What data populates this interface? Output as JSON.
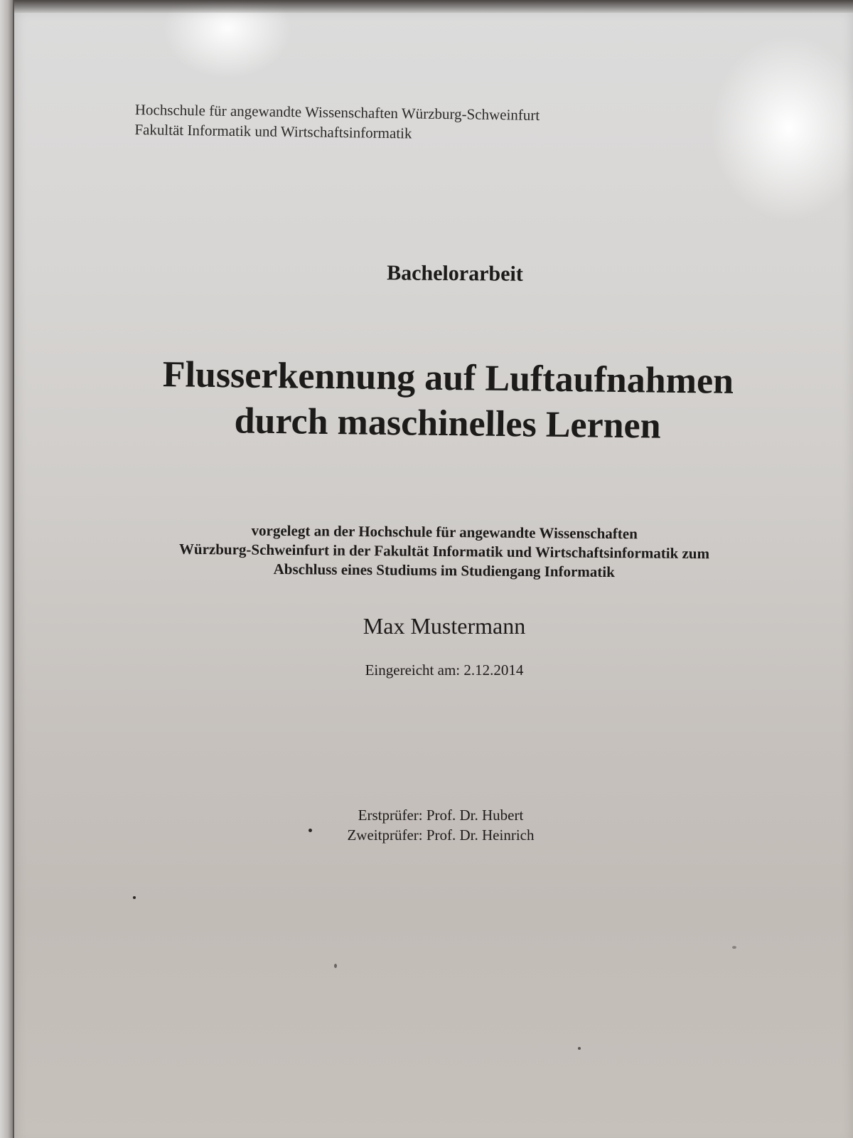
{
  "institution": {
    "line1": "Hochschule für angewandte Wissenschaften Würzburg-Schweinfurt",
    "line2": "Fakultät Informatik und Wirtschaftsinformatik"
  },
  "document_type": "Bachelorarbeit",
  "title": {
    "line1": "Flusserkennung auf Luftaufnahmen",
    "line2": "durch maschinelles Lernen"
  },
  "submission_note": {
    "line1": "vorgelegt an der Hochschule für angewandte Wissenschaften",
    "line2": "Würzburg-Schweinfurt in der Fakultät Informatik und Wirtschaftsinformatik zum",
    "line3": "Abschluss eines Studiums im Studiengang Informatik"
  },
  "author": "Max Mustermann",
  "submitted": "Eingereicht am: 2.12.2014",
  "examiners": {
    "first": "Erstprüfer: Prof. Dr. Hubert",
    "second": "Zweitprüfer: Prof. Dr. Heinrich"
  }
}
